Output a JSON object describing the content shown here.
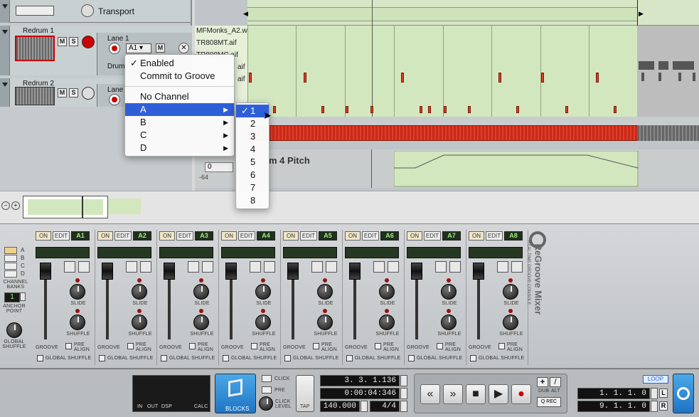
{
  "transport_track": {
    "name": "Transport"
  },
  "tracks": [
    {
      "name": "Redrum 1",
      "lane": "Lane 1",
      "lane_sub": "Drum",
      "groove_select": "A1",
      "m": "M",
      "s": "S"
    },
    {
      "name": "Redrum 2",
      "lane": "Lane",
      "m": "M",
      "s": "S"
    }
  ],
  "files": [
    "MFMonks_A2.w",
    "TR808MT.aif",
    "TR808MC.aif",
    "aif",
    "aif"
  ],
  "pitch_lane": {
    "label": "m 4 Pitch",
    "value": "0",
    "min": "-64"
  },
  "context_menu": {
    "items": [
      {
        "label": "Enabled",
        "checked": true
      },
      {
        "label": "Commit to Groove"
      },
      {
        "label": "No Channel"
      },
      {
        "label": "A",
        "submenu": true,
        "selected": true
      },
      {
        "label": "B",
        "submenu": true
      },
      {
        "label": "C",
        "submenu": true
      },
      {
        "label": "D",
        "submenu": true
      }
    ]
  },
  "submenu": {
    "items": [
      {
        "label": "1",
        "checked": true,
        "selected": true
      },
      {
        "label": "2"
      },
      {
        "label": "3"
      },
      {
        "label": "4"
      },
      {
        "label": "5"
      },
      {
        "label": "6"
      },
      {
        "label": "7"
      },
      {
        "label": "8"
      }
    ]
  },
  "mixer": {
    "title": "ReGroove Mixer",
    "subtitle": "REAL TIME GROOVE CONSOLE",
    "banks": [
      "A",
      "B",
      "C",
      "D"
    ],
    "bank_label": "CHANNEL BANKS",
    "anchor_value": "1",
    "anchor_label": "ANCHOR POINT",
    "global_shuffle_label": "GLOBAL SHUFFLE",
    "channels": [
      {
        "on": "ON",
        "edit": "EDIT",
        "name": "A1",
        "slide": "SLIDE",
        "shuffle": "SHUFFLE",
        "groove": "GROOVE",
        "pre_align": "PRE ALIGN",
        "global_shuffle": "GLOBAL SHUFFLE"
      },
      {
        "on": "ON",
        "edit": "EDIT",
        "name": "A2",
        "slide": "SLIDE",
        "shuffle": "SHUFFLE",
        "groove": "GROOVE",
        "pre_align": "PRE ALIGN",
        "global_shuffle": "GLOBAL SHUFFLE"
      },
      {
        "on": "ON",
        "edit": "EDIT",
        "name": "A3",
        "slide": "SLIDE",
        "shuffle": "SHUFFLE",
        "groove": "GROOVE",
        "pre_align": "PRE ALIGN",
        "global_shuffle": "GLOBAL SHUFFLE"
      },
      {
        "on": "ON",
        "edit": "EDIT",
        "name": "A4",
        "slide": "SLIDE",
        "shuffle": "SHUFFLE",
        "groove": "GROOVE",
        "pre_align": "PRE ALIGN",
        "global_shuffle": "GLOBAL SHUFFLE"
      },
      {
        "on": "ON",
        "edit": "EDIT",
        "name": "A5",
        "slide": "SLIDE",
        "shuffle": "SHUFFLE",
        "groove": "GROOVE",
        "pre_align": "PRE ALIGN",
        "global_shuffle": "GLOBAL SHUFFLE"
      },
      {
        "on": "ON",
        "edit": "EDIT",
        "name": "A6",
        "slide": "SLIDE",
        "shuffle": "SHUFFLE",
        "groove": "GROOVE",
        "pre_align": "PRE ALIGN",
        "global_shuffle": "GLOBAL SHUFFLE"
      },
      {
        "on": "ON",
        "edit": "EDIT",
        "name": "A7",
        "slide": "SLIDE",
        "shuffle": "SHUFFLE",
        "groove": "GROOVE",
        "pre_align": "PRE ALIGN",
        "global_shuffle": "GLOBAL SHUFFLE"
      },
      {
        "on": "ON",
        "edit": "EDIT",
        "name": "A8",
        "slide": "SLIDE",
        "shuffle": "SHUFFLE",
        "groove": "GROOVE",
        "pre_align": "PRE ALIGN",
        "global_shuffle": "GLOBAL SHUFFLE"
      }
    ]
  },
  "transport": {
    "meter_labels": [
      "IN",
      "OUT",
      "DSP",
      "CALC"
    ],
    "blocks": "BLOCKS",
    "click": "CLICK",
    "pre": "PRE",
    "click_level": "CLICK LEVEL",
    "tap": "TAP",
    "position": "3. 3. 1.136",
    "time": "0:00:04:346",
    "tempo": "140.000",
    "signature": "4/4",
    "buttons": [
      "«",
      "»",
      "■",
      "▶",
      "●"
    ],
    "dub": "DUB",
    "alt": "ALT",
    "qrec": "Q REC",
    "loop": "LOOP",
    "loop_left": "1. 1. 1.   0",
    "loop_right": "9. 1. 1.   0",
    "l": "L",
    "r": "R",
    "plus": "+",
    "slash": "/"
  },
  "colors": {
    "accent": "#2f5fd8",
    "lane_green": "#d3e7bf",
    "note_red": "#e23a1f",
    "lcd_green": "#9ef07a"
  }
}
